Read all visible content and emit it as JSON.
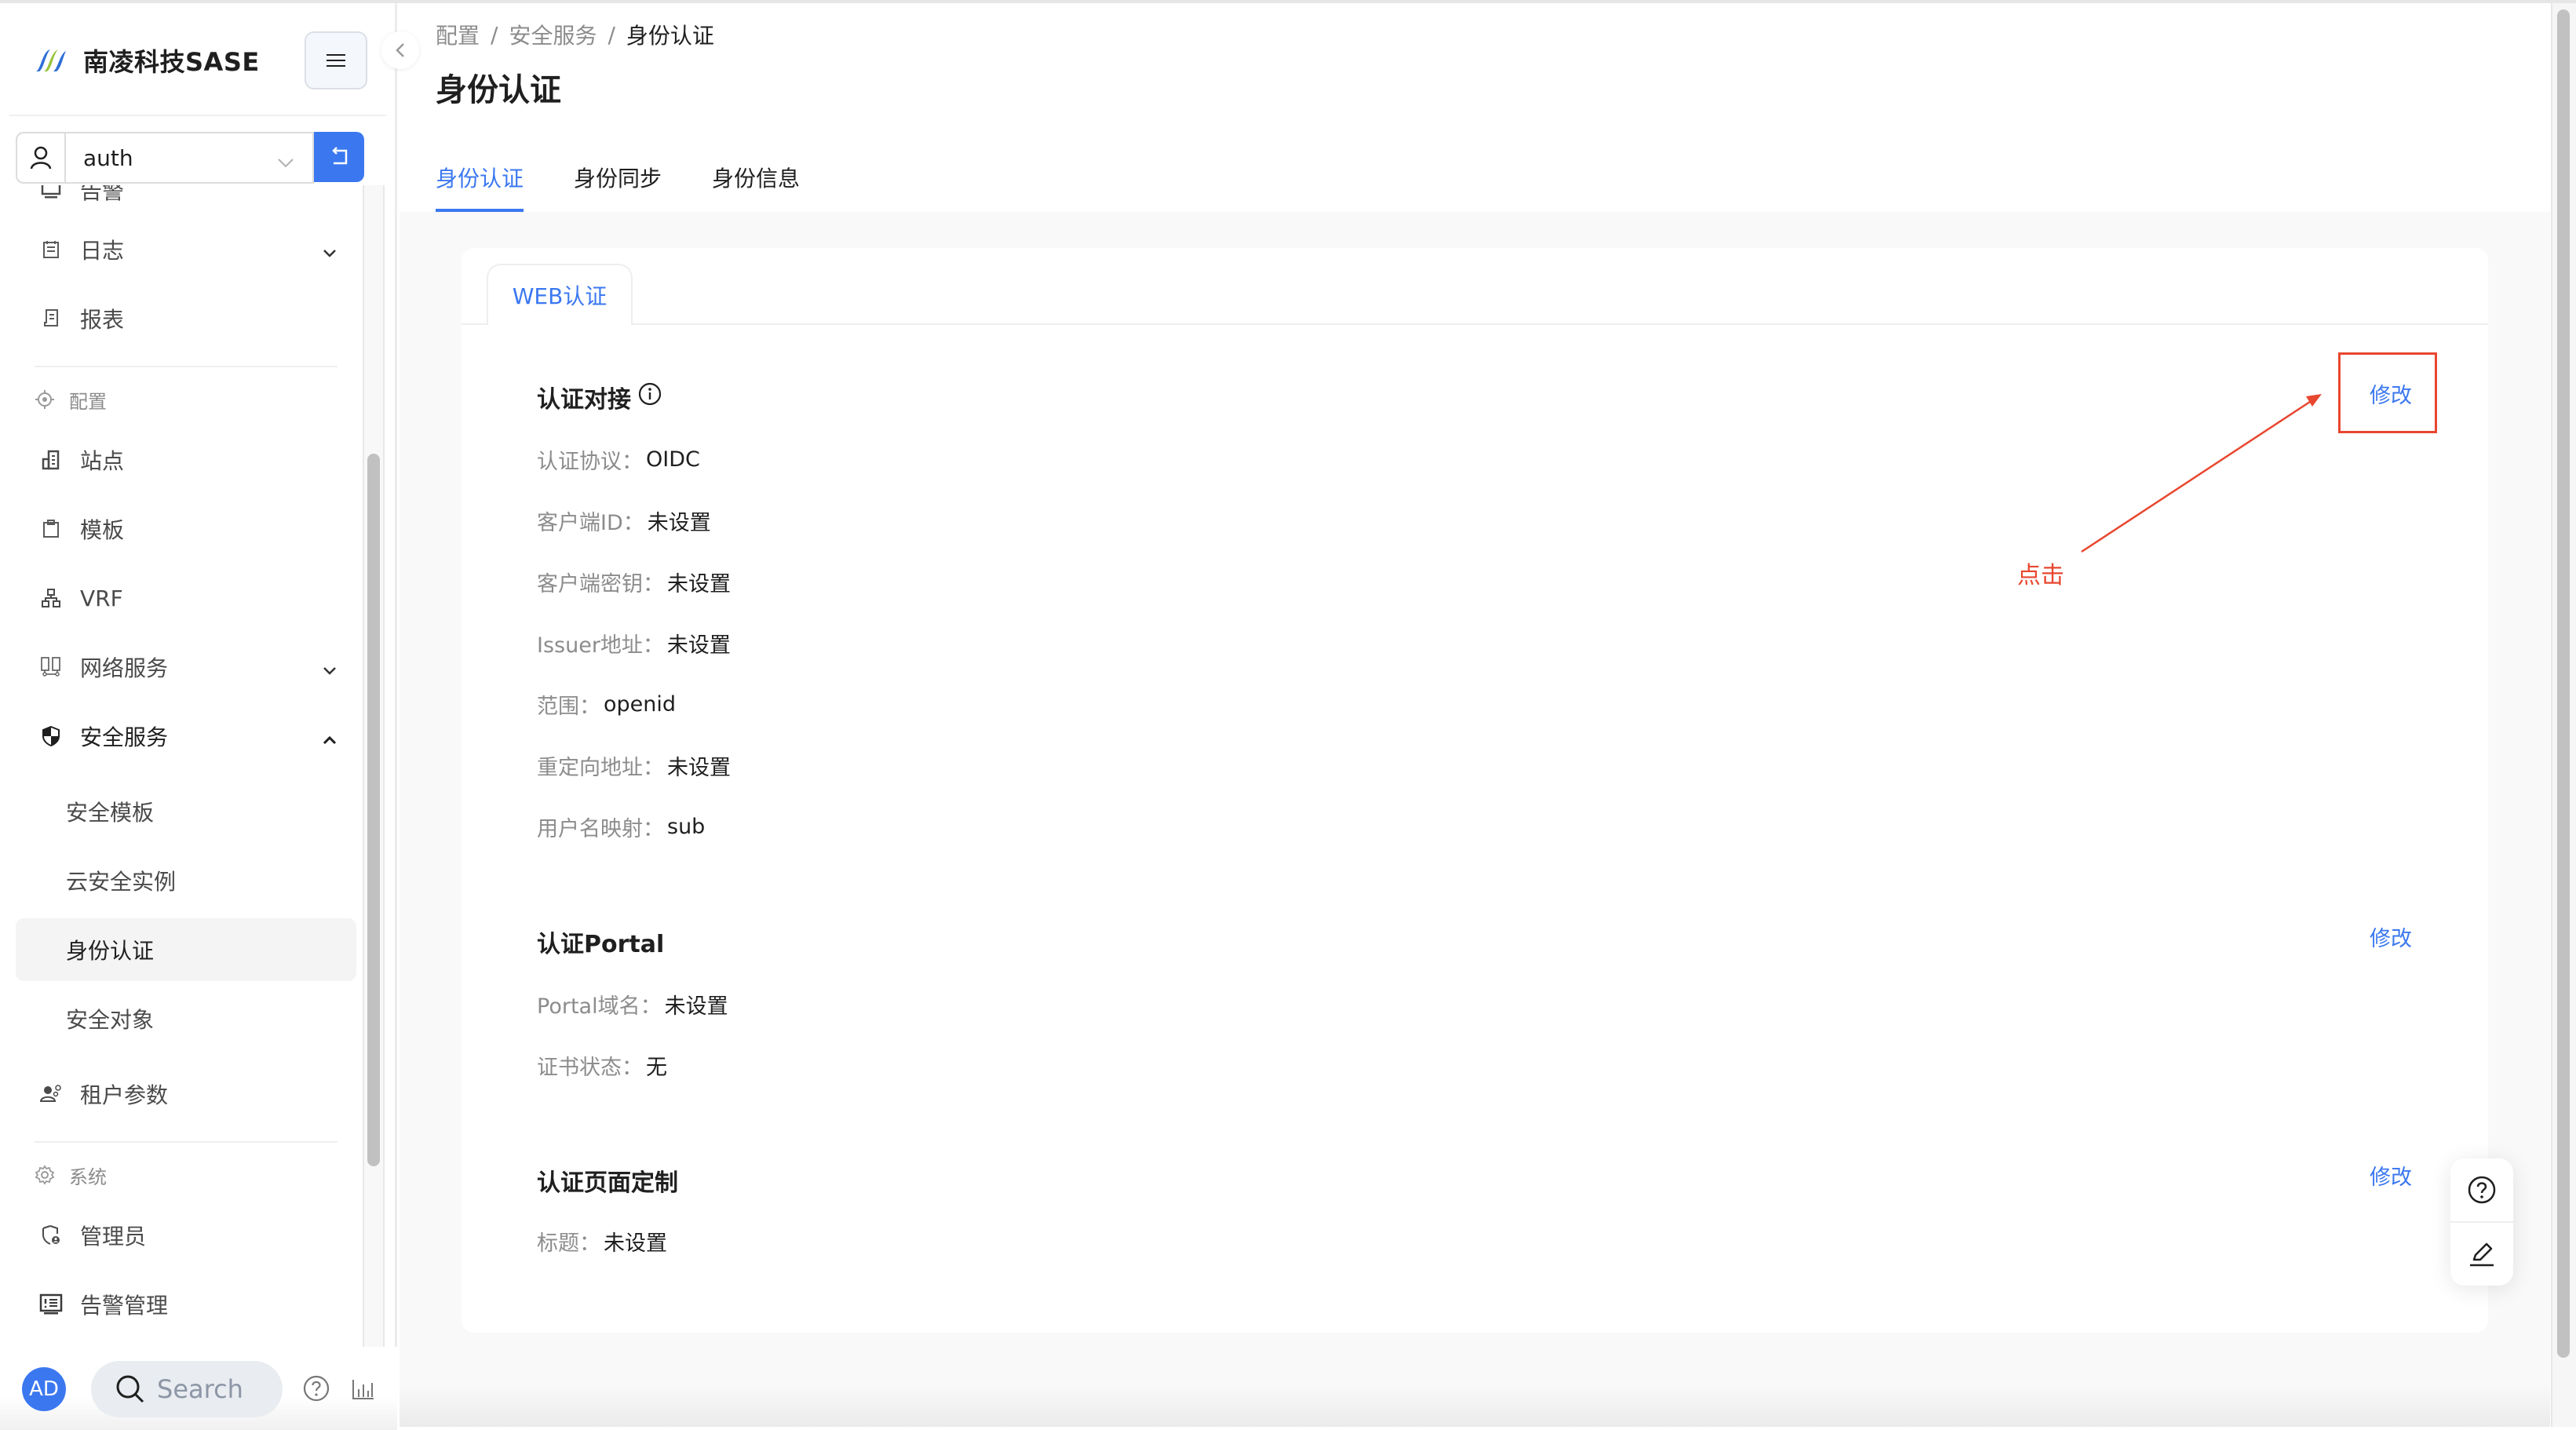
{
  "brand": {
    "name": "南凌科技SASE",
    "logo_icon": "nanling-logo-icon",
    "colors": {
      "logo_blue": "#2f6fd6",
      "logo_green": "#9ac43c"
    }
  },
  "tenant_selector": {
    "icon": "user-icon",
    "value": "auth",
    "switch_icon": "return-icon"
  },
  "sidebar": {
    "partial_item": {
      "label": "告警",
      "icon": "monitor-icon"
    },
    "items": [
      {
        "label": "日志",
        "icon": "log-icon",
        "expandable": true,
        "expanded": false
      },
      {
        "label": "报表",
        "icon": "report-icon"
      }
    ],
    "groups": [
      {
        "label": "配置",
        "icon": "target-icon",
        "items": [
          {
            "label": "站点",
            "icon": "building-icon"
          },
          {
            "label": "模板",
            "icon": "clipboard-icon"
          },
          {
            "label": "VRF",
            "icon": "network-tree-icon"
          },
          {
            "label": "网络服务",
            "icon": "network-server-icon",
            "expandable": true,
            "expanded": false
          },
          {
            "label": "安全服务",
            "icon": "shield-icon",
            "expandable": true,
            "expanded": true,
            "children": [
              {
                "label": "安全模板"
              },
              {
                "label": "云安全实例"
              },
              {
                "label": "身份认证",
                "active": true
              },
              {
                "label": "安全对象"
              }
            ]
          },
          {
            "label": "租户参数",
            "icon": "tenant-settings-icon"
          }
        ]
      },
      {
        "label": "系统",
        "icon": "gear-icon",
        "items": [
          {
            "label": "管理员",
            "icon": "admin-shield-icon"
          },
          {
            "label": "告警管理",
            "icon": "alarm-monitor-icon"
          }
        ]
      }
    ],
    "footer": {
      "avatar_initials": "AD",
      "search_placeholder": "Search",
      "help_icon": "help-circle-icon",
      "stats_icon": "bar-chart-icon"
    }
  },
  "breadcrumb": [
    "配置",
    "安全服务",
    "身份认证"
  ],
  "breadcrumb_separator": "/",
  "page_title": "身份认证",
  "tabs": [
    {
      "label": "身份认证",
      "active": true
    },
    {
      "label": "身份同步",
      "active": false
    },
    {
      "label": "身份信息",
      "active": false
    }
  ],
  "card": {
    "tab_label": "WEB认证",
    "sections": [
      {
        "title": "认证对接",
        "has_info_icon": true,
        "edit_label": "修改",
        "fields": [
          {
            "key": "认证协议：",
            "value": "OIDC"
          },
          {
            "key": "客户端ID：",
            "value": "未设置"
          },
          {
            "key": "客户端密钥：",
            "value": "未设置"
          },
          {
            "key": "Issuer地址：",
            "value": "未设置"
          },
          {
            "key": "范围：",
            "value": "openid"
          },
          {
            "key": "重定向地址：",
            "value": "未设置"
          },
          {
            "key": "用户名映射：",
            "value": "sub"
          }
        ]
      },
      {
        "title": "认证Portal",
        "edit_label": "修改",
        "fields": [
          {
            "key": "Portal域名：",
            "value": "未设置"
          },
          {
            "key": "证书状态：",
            "value": "无"
          }
        ]
      },
      {
        "title": "认证页面定制",
        "edit_label": "修改",
        "fields": [
          {
            "key": "标题：",
            "value": "未设置"
          }
        ]
      }
    ]
  },
  "annotation": {
    "text": "点击",
    "color": "#e8472f",
    "target": "认证对接 修改"
  },
  "float_toolbar": {
    "items": [
      {
        "icon": "help-circle-icon"
      },
      {
        "icon": "pencil-edit-icon"
      }
    ]
  },
  "colors": {
    "accent": "#3b78f0",
    "text_primary": "#1f1f1f",
    "text_secondary": "#8c8c8c",
    "content_bg": "#f9f9f9",
    "active_nav_bg": "#f4f4f4"
  }
}
